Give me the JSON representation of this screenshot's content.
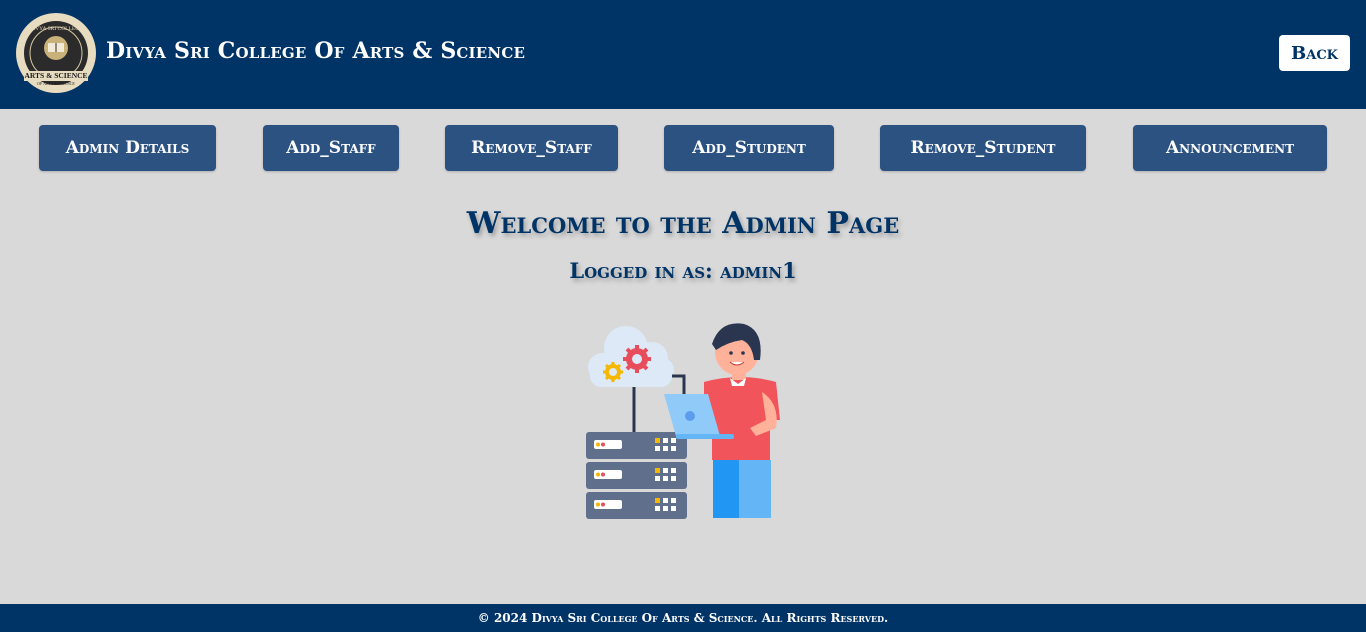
{
  "header": {
    "college_name": "Divya Sri College Of Arts & Science",
    "back_label": "Back",
    "logo_text_top": "DIVYA SRI COLLEGE",
    "logo_text_mid": "ARTS & SCIENCE",
    "logo_text_bottom": "OF ARTS & SCIENCE"
  },
  "nav": {
    "items": [
      {
        "label": "Admin Details"
      },
      {
        "label": "Add_Staff"
      },
      {
        "label": "Remove_Staff"
      },
      {
        "label": "Add_Student"
      },
      {
        "label": "Remove_Student"
      },
      {
        "label": "Announcement"
      }
    ]
  },
  "main": {
    "welcome": "Welcome to the Admin Page",
    "logged_in": "Logged in as: admin1"
  },
  "footer": {
    "text": "© 2024 Divya Sri College Of Arts & Science. All Rights Reserved."
  },
  "colors": {
    "header_bg": "#003366",
    "nav_button_bg": "#2c5282",
    "page_bg": "#d9d9d9",
    "heading_text": "#003366"
  },
  "icons": [
    "college-logo",
    "admin-illustration"
  ]
}
